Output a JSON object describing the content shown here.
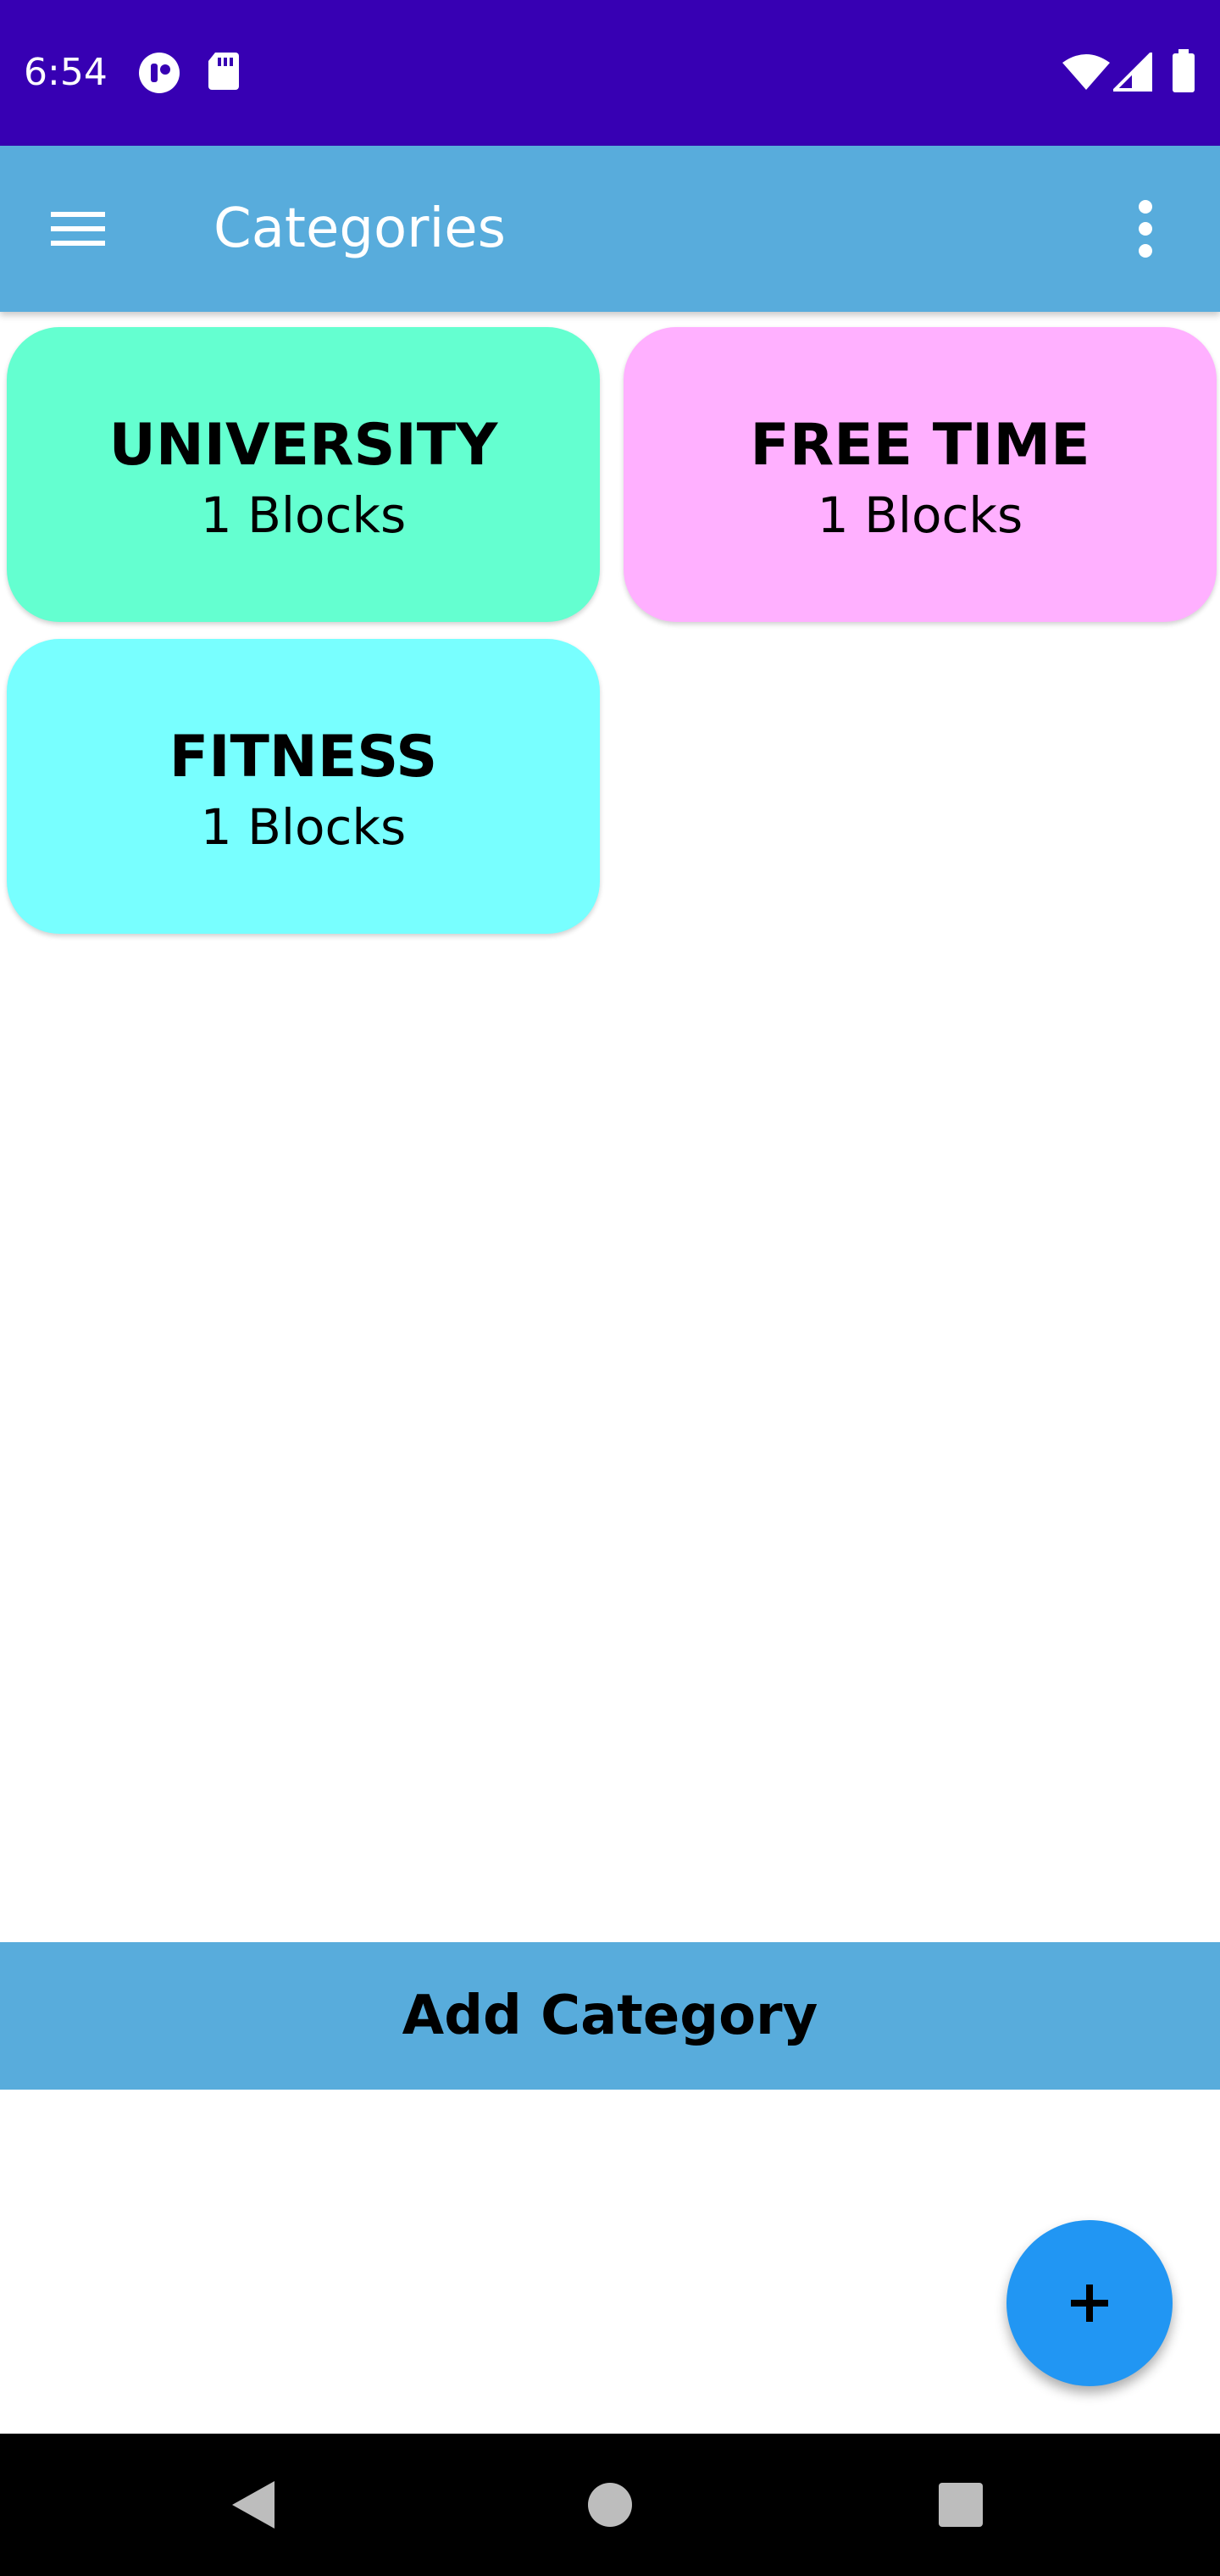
{
  "status_bar": {
    "time": "6:54",
    "left_icons": [
      "app-notification-icon",
      "sd-card-icon"
    ],
    "right_icons": [
      "wifi-icon",
      "signal-icon",
      "battery-icon"
    ],
    "background": "#3700b3"
  },
  "app_bar": {
    "title": "Categories",
    "menu_icon": "hamburger-menu-icon",
    "overflow_icon": "more-vert-icon",
    "background": "#58acdc"
  },
  "categories": [
    {
      "name": "UNIVERSITY",
      "count_label": "1 Blocks",
      "color": "#64ffd0"
    },
    {
      "name": "FREE TIME",
      "count_label": "1 Blocks",
      "color": "#ffb0ff"
    },
    {
      "name": "FITNESS",
      "count_label": "1 Blocks",
      "color": "#78ffff"
    }
  ],
  "add_category": {
    "label": "Add Category",
    "background": "#58acdc"
  },
  "fab": {
    "icon": "plus-icon",
    "color": "#2196f3"
  },
  "nav_bar": {
    "icons": [
      "back-icon",
      "home-icon",
      "recents-icon"
    ]
  }
}
